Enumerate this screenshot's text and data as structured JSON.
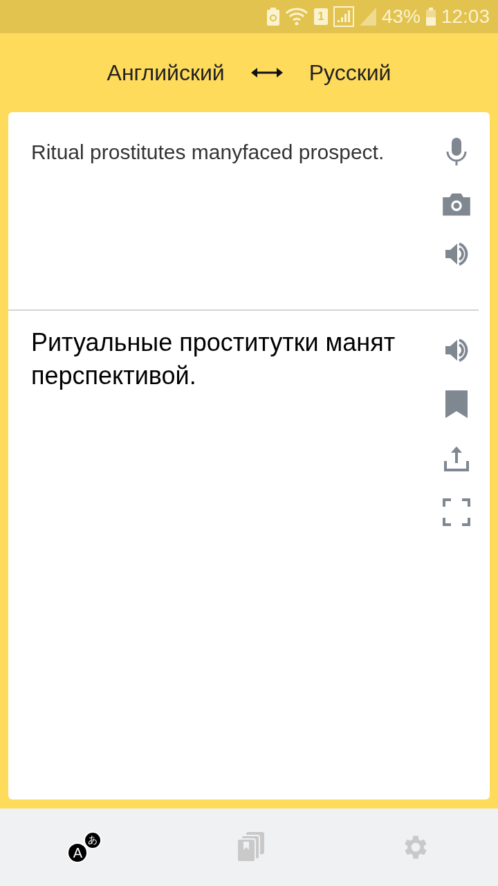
{
  "status_bar": {
    "sim": "1",
    "battery": "43%",
    "time": "12:03"
  },
  "languages": {
    "source": "Английский",
    "target": "Русский"
  },
  "source": {
    "text": "Ritual prostitutes manyfaced prospect."
  },
  "translation": {
    "text": "Ритуальные проститутки манят перспективой."
  },
  "nav": [
    {
      "kind": "translate",
      "selected": true,
      "glyphs": [
        "A",
        "あ"
      ]
    },
    {
      "kind": "collections",
      "selected": false
    },
    {
      "kind": "settings",
      "selected": false
    }
  ]
}
